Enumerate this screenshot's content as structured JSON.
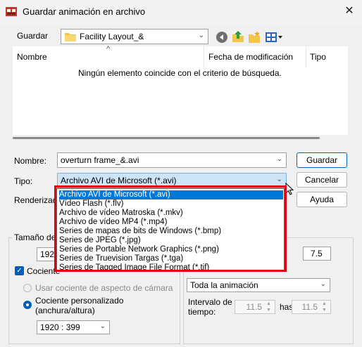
{
  "window": {
    "title": "Guardar animación en archivo",
    "close": "✕"
  },
  "location": {
    "label": "Guardar",
    "folder": "Facility Layout_&"
  },
  "columns": {
    "name": "Nombre",
    "date": "Fecha de modificación",
    "type": "Tipo"
  },
  "empty_message": "Ningún elemento coincide con el criterio de búsqueda.",
  "sort_glyph": "^",
  "name_field": {
    "label": "Nombre:",
    "value": "overturn frame_&.avi"
  },
  "type_field": {
    "label": "Tipo:",
    "value": "Archivo AVI de Microsoft (*.avi)"
  },
  "render_label": "Renderizad",
  "buttons": {
    "save": "Guardar",
    "cancel": "Cancelar",
    "help": "Ayuda"
  },
  "type_options": [
    "Archivo AVI de Microsoft (*.avi)",
    "Vídeo Flash (*.flv)",
    "Archivo de vídeo Matroska (*.mkv)",
    "Archivo de vídeo MP4 (*.mp4)",
    "Series de mapas de bits de Windows (*.bmp)",
    "Series de JPEG (*.jpg)",
    "Series de Portable Network Graphics (*.png)",
    "Series de Truevision Targas (*.tga)",
    "Series de Tagged Image File Format (*.tif)"
  ],
  "size_group": {
    "title": "Tamaño de",
    "size_value": "1920",
    "ratio_check": "Cociente",
    "camera_ratio": "Usar cociente de aspecto de cámara",
    "custom_ratio_line1": "Cociente personalizado",
    "custom_ratio_line2": "(anchura/altura)",
    "ratio_value": "1920 : 399"
  },
  "time_group": {
    "fps_value": "7.5",
    "range_value": "Toda la animación",
    "interval_line1": "Intervalo de",
    "interval_line2": "tiempo:",
    "from_value": "11.5",
    "to_label": "has",
    "to_value": "11.5"
  },
  "colors": {
    "accent": "#0078d7",
    "highlight": "#e00012"
  }
}
